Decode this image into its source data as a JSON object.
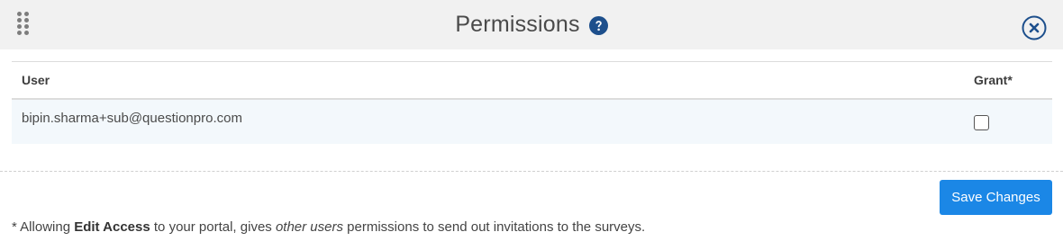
{
  "header": {
    "title": "Permissions",
    "help_icon": "question-circle-icon",
    "close_icon": "close-circle-icon",
    "drag_icon": "drag-handle-icon"
  },
  "table": {
    "columns": {
      "user": "User",
      "grant": "Grant*"
    },
    "rows": [
      {
        "user": "bipin.sharma+sub@questionpro.com",
        "grant": false
      }
    ]
  },
  "actions": {
    "save_label": "Save Changes"
  },
  "footnote": {
    "prefix": "* Allowing ",
    "bold": "Edit Access",
    "middle": " to your portal, gives ",
    "italic": "other users",
    "suffix": " permissions to send out invitations to the surveys."
  },
  "colors": {
    "accent": "#1b87e6",
    "icon_navy": "#1d4f8c",
    "header_bg": "#f1f1f1",
    "row_bg": "#f3f8fc"
  }
}
